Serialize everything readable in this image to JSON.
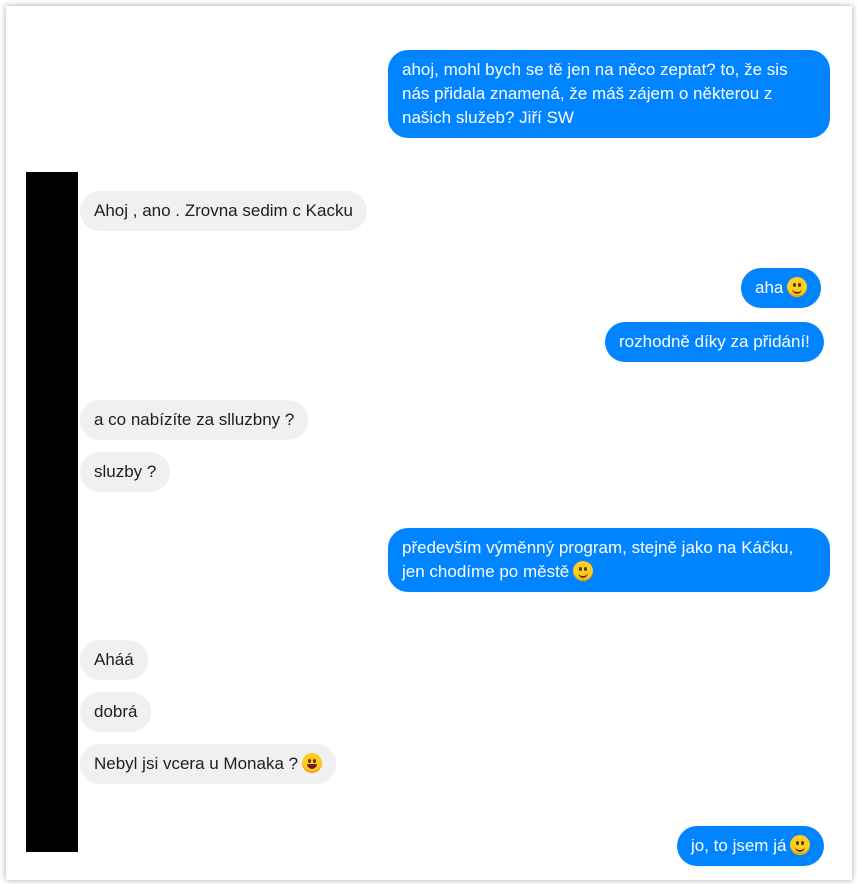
{
  "messages": [
    {
      "dir": "out",
      "text": "ahoj, mohl bych se tě jen na něco zeptat? to, že sis nás přidala znamená, že máš zájem o některou z našich služeb? Jiří SW",
      "emoji": ""
    },
    {
      "dir": "in",
      "text": "Ahoj , ano . Zrovna sedim c Kacku",
      "emoji": ""
    },
    {
      "dir": "out",
      "text": "aha",
      "emoji": "smile"
    },
    {
      "dir": "out",
      "text": "rozhodně díky za přidání!",
      "emoji": ""
    },
    {
      "dir": "in",
      "text": "a co nabízíte za slluzbny ?",
      "emoji": ""
    },
    {
      "dir": "in",
      "text": "sluzby ?",
      "emoji": ""
    },
    {
      "dir": "out",
      "text": "především výměnný program, stejně jako na Káčku, jen chodíme po městě",
      "emoji": "smile"
    },
    {
      "dir": "in",
      "text": "Aháá",
      "emoji": ""
    },
    {
      "dir": "in",
      "text": "dobrá",
      "emoji": ""
    },
    {
      "dir": "in",
      "text": "Nebyl jsi vcera u Monaka ?",
      "emoji": "grin"
    },
    {
      "dir": "out",
      "text": "jo, to jsem já",
      "emoji": "smile"
    }
  ],
  "colors": {
    "outgoing": "#0084ff",
    "incoming": "#f1f0f0",
    "redaction": "#000000"
  }
}
